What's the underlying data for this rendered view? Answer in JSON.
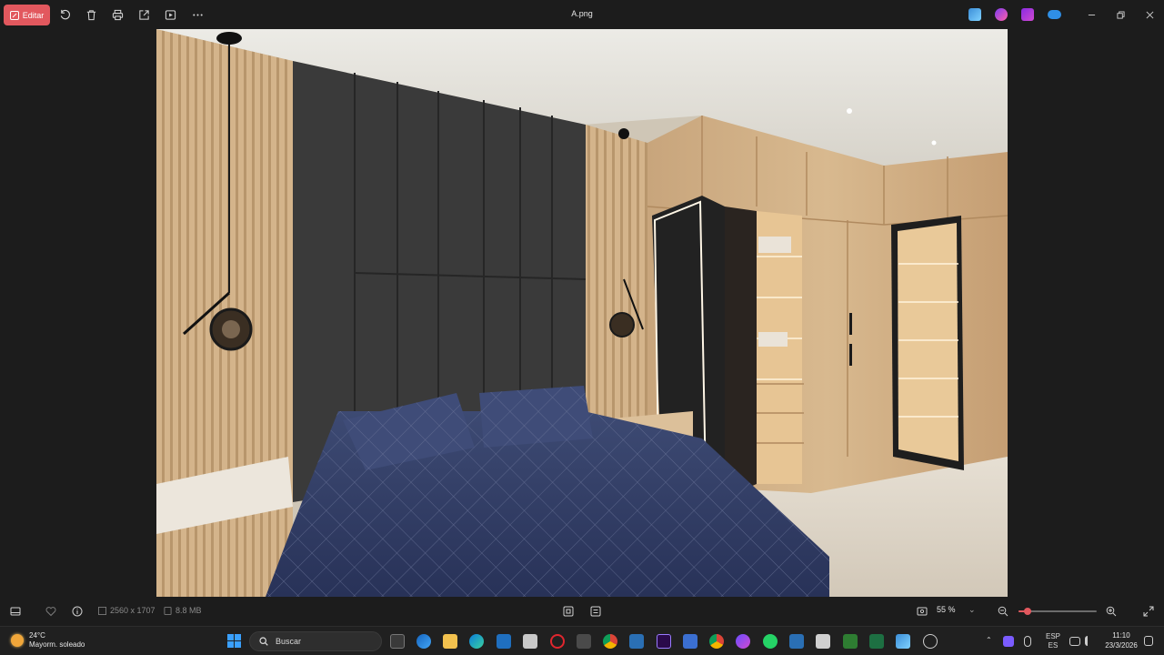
{
  "window": {
    "title": "A.png",
    "edit_label": "Editar"
  },
  "image_info": {
    "dimensions": "2560 x 1707",
    "file_size": "8.8 MB"
  },
  "zoom": {
    "label": "55 %",
    "level": 0.12
  },
  "taskbar": {
    "weather_temp": "24°C",
    "weather_desc": "Mayorm. soleado",
    "search_label": "Buscar",
    "lang_top": "ESP",
    "lang_bottom": "ES",
    "time": "11:10",
    "date": "23/3/2026"
  },
  "colors": {
    "accent": "#e2585e",
    "background": "#1c1c1c",
    "taskbar": "#202020"
  },
  "icons": {
    "toolbar": [
      "rotate-icon",
      "delete-icon",
      "print-icon",
      "share-icon",
      "slideshow-icon",
      "more-icon"
    ],
    "titlebar_apps": [
      "photos-app-icon",
      "clipchamp-icon",
      "designer-icon",
      "onedrive-icon"
    ],
    "taskbar_apps": [
      "task-view-icon",
      "outlook-icon",
      "file-explorer-icon",
      "edge-icon",
      "store-icon",
      "teams-icon",
      "opera-icon",
      "calculator-icon",
      "chrome-icon",
      "sketchup-icon",
      "premiere-icon",
      "layers-icon",
      "chrome-alt-icon",
      "messenger-icon",
      "whatsapp-icon",
      "sketchup-alt-icon",
      "snipping-icon",
      "photos-icon",
      "excel-icon",
      "photos-active-icon",
      "settings-icon"
    ]
  }
}
